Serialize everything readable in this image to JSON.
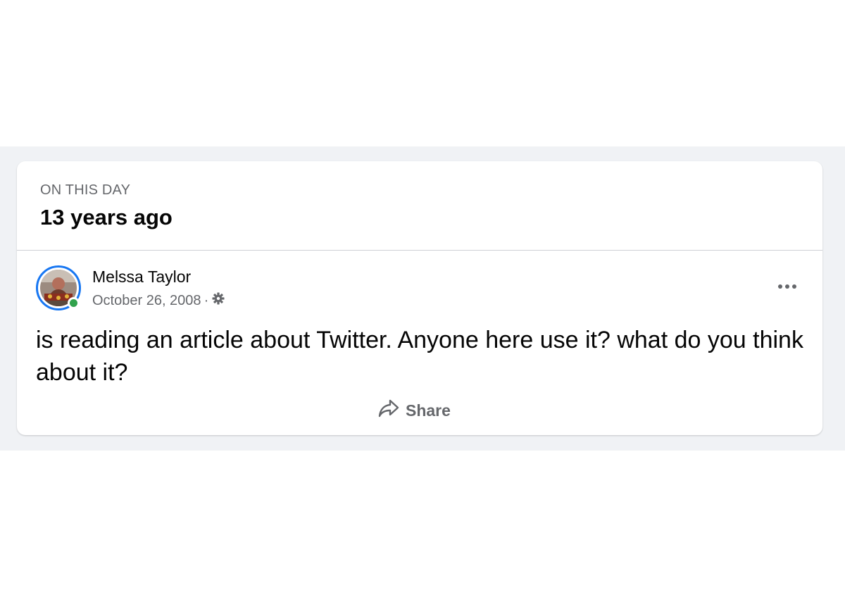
{
  "memory": {
    "kicker": "ON THIS DAY",
    "title": "13 years ago"
  },
  "post": {
    "author": "Melssa Taylor",
    "date": "October 26, 2008",
    "separator": "·",
    "privacy_icon": "gear-icon",
    "more_icon": "more-options-icon",
    "text": "is reading an article about Twitter. Anyone here use it? what do you think about it?",
    "online": true
  },
  "actions": {
    "share_label": "Share",
    "share_icon": "share-arrow-icon"
  },
  "colors": {
    "accent": "#1877f2",
    "online": "#31a24c",
    "secondary_text": "#65676b",
    "feed_background": "#f0f2f5"
  }
}
